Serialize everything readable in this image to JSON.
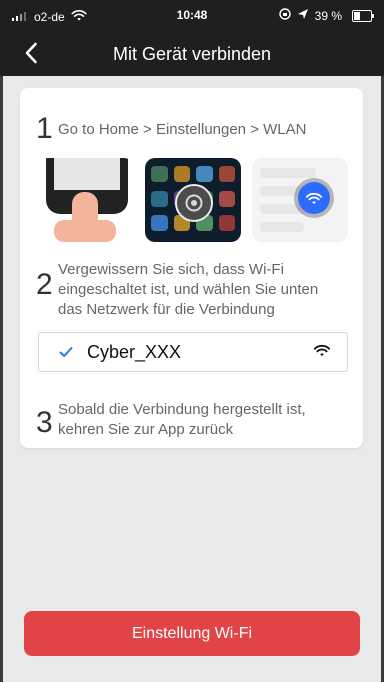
{
  "status_bar": {
    "carrier": "o2-de",
    "time": "10:48",
    "battery": "39 %",
    "battery_level": 0.39
  },
  "nav": {
    "title": "Mit Gerät verbinden"
  },
  "steps": [
    {
      "number": "1",
      "text": "Go to Home > Einstellungen > WLAN"
    },
    {
      "number": "2",
      "text": "Vergewissern Sie sich, dass Wi-Fi eingeschaltet ist, und wählen Sie unten das Netzwerk für die Verbindung"
    },
    {
      "number": "3",
      "text": "Sobald die Verbindung hergestellt ist, kehren Sie zur App zurück"
    }
  ],
  "wifi": {
    "ssid": "Cyber_XXX",
    "icons": [
      "check-icon",
      "wifi-signal-icon"
    ]
  },
  "button": {
    "label": "Einstellung Wi-Fi"
  },
  "colors": {
    "header_bg": "#1f1f1f",
    "accent": "#e04447",
    "check_blue": "#2d79e6"
  }
}
